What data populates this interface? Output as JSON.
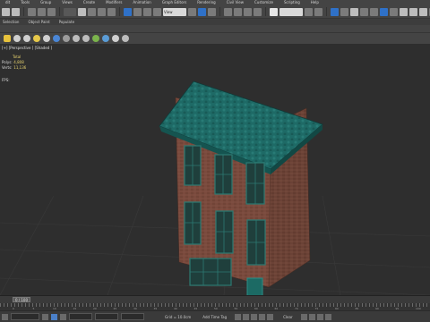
{
  "menu": {
    "items": [
      "dit",
      "Tools",
      "Group",
      "Views",
      "Create",
      "Modifiers",
      "Animation",
      "Graph Editors",
      "Rendering",
      "Civil View",
      "Customize",
      "Scripting",
      "Help"
    ]
  },
  "ribbon": {
    "tabs": [
      "Selection",
      "Object Paint",
      "Populate"
    ]
  },
  "main_toolbar": {
    "view_dropdown": "View"
  },
  "viewport": {
    "label": "[+] [Perspective ] [Shaded ]",
    "stats": {
      "total_header": "Total",
      "polys_label": "Polys:",
      "polys_value": "4,808",
      "verts_label": "Verts:",
      "verts_value": "11,136",
      "fps_label": "FPS:"
    },
    "colors": {
      "background": "#2e2e2e",
      "grid": "#3c3c3c",
      "wall": "#7a4a3d",
      "roof": "#1e6a66",
      "trim": "#1a5c5a"
    }
  },
  "timeline": {
    "frame_display": "0 / 100",
    "tick_labels": [
      "0",
      "5",
      "10",
      "15",
      "20",
      "25",
      "30",
      "35",
      "40",
      "45",
      "50",
      "55",
      "60",
      "65",
      "70",
      "75",
      "80",
      "85",
      "90",
      "95",
      "100"
    ]
  },
  "statusbar": {
    "grid_text": "Grid = 10.0cm",
    "add_time_tag": "Add Time Tag",
    "key_mode": "Clear"
  }
}
